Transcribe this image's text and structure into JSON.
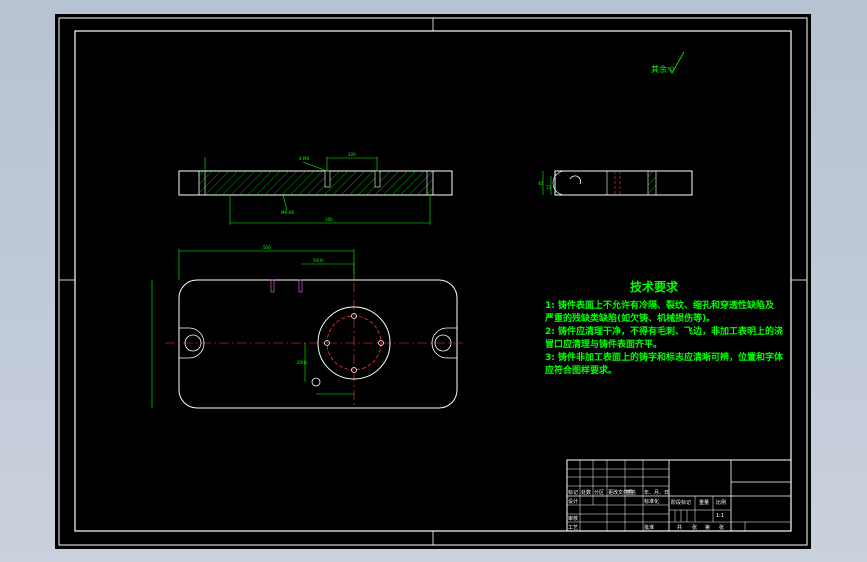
{
  "roughness": {
    "label": "其余"
  },
  "technical_requirements": {
    "title": "技术要求",
    "lines": [
      "1: 铸件表面上不允许有冷隔、裂纹、缩孔和穿透性缺陷及",
      "严重的残缺类缺陷(如欠铸、机械损伤等)。",
      "2: 铸件应清理干净，不得有毛刺、飞边，非加工表明上的浇",
      "冒口应清理与铸件表面齐平。",
      "3: 铸件非加工表面上的铸字和标志应清晰可辨，位置和字体",
      "应符合图样要求。"
    ]
  },
  "dimensions": {
    "overall_length": "500",
    "bottom_length": "100",
    "slot_width": "200",
    "hole_spec": "4-M8",
    "slot_offset": "M6-H6",
    "height_left": "40",
    "height_right": "15",
    "center_offset_v": "20(h)",
    "center_offset_h": "50(h)"
  },
  "title_block": {
    "row1": [
      "标记",
      "处数",
      "分区",
      "更改文件号",
      "签名",
      "年、月、日"
    ],
    "row2": [
      "设计",
      "",
      "",
      "标准化"
    ],
    "row3": [
      "审核"
    ],
    "row4": [
      "工艺",
      "",
      "",
      "批准"
    ],
    "stage_labels": [
      "阶段标记",
      "重量",
      "比例"
    ],
    "scale": "1:1",
    "sheet_labels": [
      "共",
      "张",
      "第",
      "张"
    ]
  }
}
